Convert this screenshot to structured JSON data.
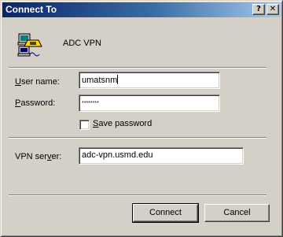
{
  "window": {
    "title": "Connect To",
    "help_glyph": "?",
    "close_glyph": "✕"
  },
  "connection": {
    "name": "ADC VPN",
    "icon": "dialup-network-icon"
  },
  "form": {
    "username_label_accel": "U",
    "username_label_rest": "ser name:",
    "username_value": "umatsnm",
    "password_label_accel": "P",
    "password_label_rest": "assword:",
    "password_mask": "********",
    "save_password_accel": "S",
    "save_password_rest": "ave password",
    "save_password_checked": false,
    "vpn_label_start": "VPN ser",
    "vpn_label_accel": "v",
    "vpn_label_end": "er:",
    "vpn_value": "adc-vpn.usmd.edu"
  },
  "buttons": {
    "connect": "Connect",
    "cancel": "Cancel"
  }
}
